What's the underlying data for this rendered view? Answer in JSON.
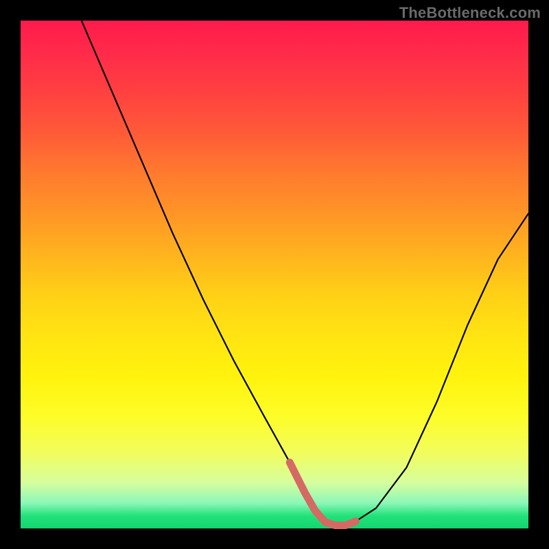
{
  "watermark": "TheBottleneck.com",
  "chart_data": {
    "type": "line",
    "title": "",
    "xlabel": "",
    "ylabel": "",
    "xlim": [
      0,
      100
    ],
    "ylim": [
      0,
      100
    ],
    "grid": false,
    "legend": false,
    "series": [
      {
        "name": "bottleneck-curve",
        "x": [
          12,
          18,
          24,
          30,
          36,
          42,
          48,
          53,
          56,
          58,
          60,
          62,
          64,
          66,
          70,
          76,
          82,
          88,
          94,
          100
        ],
        "y": [
          100,
          86,
          72,
          58,
          45,
          33,
          22,
          13,
          7,
          3.5,
          1.2,
          0.6,
          0.6,
          1.4,
          4,
          12,
          25,
          40,
          53,
          62
        ]
      }
    ],
    "optimal_range_x": [
      53,
      66
    ],
    "annotations": []
  }
}
